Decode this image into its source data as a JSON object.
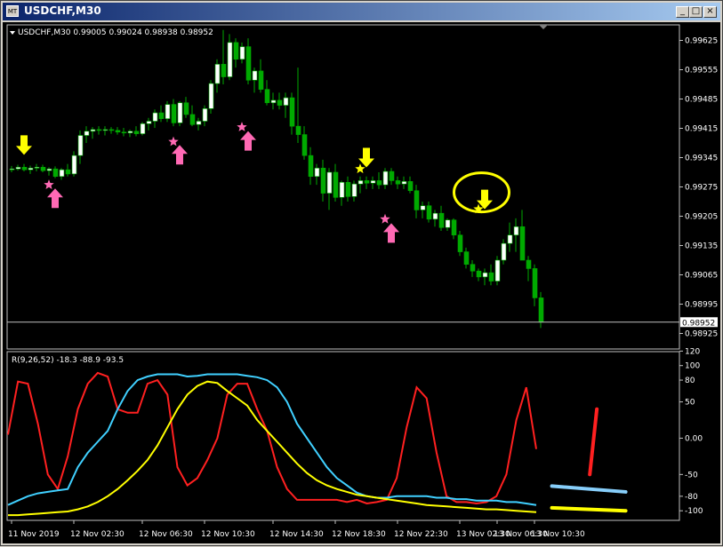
{
  "window": {
    "title": "USDCHF,M30",
    "icon_label": "MT",
    "minimize_label": "_",
    "maximize_label": "□",
    "close_label": "×"
  },
  "price_chart": {
    "header": "USDCHF,M30  0.99005 0.99024 0.98938 0.98952",
    "current_price": 0.98952,
    "current_price_label": "0.98952",
    "y_range": [
      0.9889,
      0.9966
    ],
    "y_ticks": [
      "0.99625",
      "0.99555",
      "0.99485",
      "0.99415",
      "0.99345",
      "0.99275",
      "0.99205",
      "0.99135",
      "0.99065",
      "0.98995",
      "0.98925"
    ],
    "candles": [
      [
        0.99317,
        0.99325,
        0.9931,
        0.99318
      ],
      [
        0.99318,
        0.99328,
        0.99314,
        0.99322
      ],
      [
        0.99322,
        0.9933,
        0.99312,
        0.99316
      ],
      [
        0.99316,
        0.99326,
        0.99306,
        0.9932
      ],
      [
        0.9932,
        0.9933,
        0.99312,
        0.99322
      ],
      [
        0.99322,
        0.99328,
        0.9931,
        0.99314
      ],
      [
        0.99314,
        0.99322,
        0.99302,
        0.99318
      ],
      [
        0.99318,
        0.99324,
        0.99296,
        0.993
      ],
      [
        0.993,
        0.9932,
        0.99292,
        0.99316
      ],
      [
        0.99316,
        0.9933,
        0.993,
        0.99306
      ],
      [
        0.99306,
        0.9936,
        0.993,
        0.9935
      ],
      [
        0.9935,
        0.9941,
        0.9933,
        0.99398
      ],
      [
        0.99398,
        0.9942,
        0.9938,
        0.99408
      ],
      [
        0.99408,
        0.99418,
        0.9939,
        0.99412
      ],
      [
        0.99412,
        0.9942,
        0.994,
        0.9941
      ],
      [
        0.9941,
        0.9942,
        0.99398,
        0.99412
      ],
      [
        0.99412,
        0.99418,
        0.99402,
        0.9941
      ],
      [
        0.9941,
        0.99418,
        0.994,
        0.99406
      ],
      [
        0.99406,
        0.99416,
        0.99396,
        0.99404
      ],
      [
        0.99404,
        0.99412,
        0.99394,
        0.99408
      ],
      [
        0.99408,
        0.9942,
        0.99396,
        0.99402
      ],
      [
        0.99402,
        0.9943,
        0.99398,
        0.99426
      ],
      [
        0.99426,
        0.9944,
        0.9941,
        0.99432
      ],
      [
        0.99432,
        0.9946,
        0.99416,
        0.99452
      ],
      [
        0.99452,
        0.9947,
        0.9943,
        0.99438
      ],
      [
        0.99438,
        0.9948,
        0.9943,
        0.99472
      ],
      [
        0.99472,
        0.99485,
        0.9942,
        0.99428
      ],
      [
        0.99428,
        0.9948,
        0.9942,
        0.99476
      ],
      [
        0.99476,
        0.9949,
        0.9944,
        0.99448
      ],
      [
        0.99448,
        0.9947,
        0.9942,
        0.99424
      ],
      [
        0.99424,
        0.9944,
        0.9941,
        0.99432
      ],
      [
        0.99432,
        0.9947,
        0.9942,
        0.99462
      ],
      [
        0.99462,
        0.9953,
        0.9945,
        0.99522
      ],
      [
        0.99522,
        0.9958,
        0.995,
        0.99568
      ],
      [
        0.99568,
        0.9965,
        0.9952,
        0.99538
      ],
      [
        0.99538,
        0.9964,
        0.9953,
        0.9962
      ],
      [
        0.9962,
        0.9963,
        0.9956,
        0.9958
      ],
      [
        0.9958,
        0.9962,
        0.9957,
        0.9961
      ],
      [
        0.9961,
        0.9963,
        0.9952,
        0.9953
      ],
      [
        0.9953,
        0.9956,
        0.995,
        0.99552
      ],
      [
        0.99552,
        0.9958,
        0.995,
        0.99508
      ],
      [
        0.99508,
        0.9953,
        0.9947,
        0.99476
      ],
      [
        0.99476,
        0.995,
        0.9946,
        0.99482
      ],
      [
        0.99482,
        0.995,
        0.9946,
        0.9947
      ],
      [
        0.9947,
        0.995,
        0.9944,
        0.99488
      ],
      [
        0.99488,
        0.995,
        0.994,
        0.9942
      ],
      [
        0.9942,
        0.9956,
        0.9938,
        0.994
      ],
      [
        0.994,
        0.9942,
        0.9934,
        0.9935
      ],
      [
        0.9935,
        0.9937,
        0.9928,
        0.993
      ],
      [
        0.993,
        0.9933,
        0.9928,
        0.9932
      ],
      [
        0.9932,
        0.9934,
        0.9924,
        0.9926
      ],
      [
        0.9926,
        0.9932,
        0.9922,
        0.9931
      ],
      [
        0.9931,
        0.9933,
        0.9924,
        0.9925
      ],
      [
        0.9925,
        0.9929,
        0.9923,
        0.99286
      ],
      [
        0.99286,
        0.993,
        0.9924,
        0.99252
      ],
      [
        0.99252,
        0.9929,
        0.9924,
        0.99282
      ],
      [
        0.99282,
        0.993,
        0.9926,
        0.9929
      ],
      [
        0.9929,
        0.993,
        0.9927,
        0.99284
      ],
      [
        0.99284,
        0.993,
        0.9927,
        0.9929
      ],
      [
        0.9929,
        0.9931,
        0.9927,
        0.9928
      ],
      [
        0.9928,
        0.9932,
        0.9927,
        0.99312
      ],
      [
        0.99312,
        0.9932,
        0.9928,
        0.9929
      ],
      [
        0.9929,
        0.993,
        0.9927,
        0.99282
      ],
      [
        0.99282,
        0.993,
        0.9927,
        0.99288
      ],
      [
        0.99288,
        0.993,
        0.9926,
        0.99266
      ],
      [
        0.99266,
        0.9928,
        0.992,
        0.9922
      ],
      [
        0.9922,
        0.9924,
        0.992,
        0.9923
      ],
      [
        0.9923,
        0.9924,
        0.9919,
        0.99198
      ],
      [
        0.99198,
        0.9922,
        0.9918,
        0.99212
      ],
      [
        0.99212,
        0.9923,
        0.9917,
        0.99178
      ],
      [
        0.99178,
        0.992,
        0.9917,
        0.99196
      ],
      [
        0.99196,
        0.992,
        0.9915,
        0.9916
      ],
      [
        0.9916,
        0.9917,
        0.9911,
        0.9912
      ],
      [
        0.9912,
        0.9913,
        0.9908,
        0.9909
      ],
      [
        0.9909,
        0.991,
        0.9906,
        0.99074
      ],
      [
        0.99074,
        0.9908,
        0.9905,
        0.9906
      ],
      [
        0.9906,
        0.9908,
        0.9904,
        0.9907
      ],
      [
        0.9907,
        0.9909,
        0.9904,
        0.9905
      ],
      [
        0.9905,
        0.9911,
        0.9904,
        0.991
      ],
      [
        0.991,
        0.9915,
        0.9909,
        0.9914
      ],
      [
        0.9914,
        0.9919,
        0.9912,
        0.9916
      ],
      [
        0.9916,
        0.992,
        0.9912,
        0.9918
      ],
      [
        0.9918,
        0.9922,
        0.9916,
        0.991
      ],
      [
        0.991,
        0.9911,
        0.9905,
        0.9908
      ],
      [
        0.9908,
        0.9909,
        0.9899,
        0.9901
      ],
      [
        0.9901,
        0.99024,
        0.98938,
        0.98952
      ]
    ],
    "markers": [
      {
        "type": "arrow-down",
        "color": "#ffff00",
        "bar": 2,
        "price": 0.99375
      },
      {
        "type": "star",
        "color": "#ff69b4",
        "bar": 6,
        "price": 0.9928
      },
      {
        "type": "arrow-up",
        "color": "#ff69b4",
        "bar": 7,
        "price": 0.99248
      },
      {
        "type": "star",
        "color": "#ff69b4",
        "bar": 26,
        "price": 0.99383
      },
      {
        "type": "arrow-up",
        "color": "#ff69b4",
        "bar": 27,
        "price": 0.99352
      },
      {
        "type": "star",
        "color": "#ff69b4",
        "bar": 37,
        "price": 0.99418
      },
      {
        "type": "arrow-up",
        "color": "#ff69b4",
        "bar": 38,
        "price": 0.99385
      },
      {
        "type": "arrow-down",
        "color": "#ffff00",
        "bar": 57,
        "price": 0.99345
      },
      {
        "type": "star",
        "color": "#ffff00",
        "bar": 56,
        "price": 0.99318
      },
      {
        "type": "star",
        "color": "#ff69b4",
        "bar": 60,
        "price": 0.99198
      },
      {
        "type": "arrow-up",
        "color": "#ff69b4",
        "bar": 61,
        "price": 0.99165
      },
      {
        "type": "arrow-down",
        "color": "#ffff00",
        "bar": 76,
        "price": 0.99245
      },
      {
        "type": "star",
        "color": "#ffff00",
        "bar": 75,
        "price": 0.99222
      }
    ],
    "annotation_circle": {
      "bar": 75.5,
      "price": 0.99262,
      "color": "#ffff00"
    }
  },
  "indicator": {
    "header": "R(9,26,52) -18.3 -88.9 -93.5",
    "y_range": [
      -112,
      118
    ],
    "y_ticks": [
      "120",
      "100",
      "80",
      "50",
      "0.00",
      "-50",
      "-80",
      "-100"
    ],
    "y_tick_values": [
      120,
      100,
      80,
      50,
      0,
      -50,
      -80,
      -100
    ],
    "series": [
      {
        "color": "#ff2020",
        "values": [
          5,
          78,
          75,
          20,
          -50,
          -70,
          -25,
          40,
          75,
          90,
          85,
          40,
          35,
          35,
          75,
          80,
          60,
          -40,
          -65,
          -55,
          -30,
          0,
          60,
          75,
          75,
          40,
          10,
          -40,
          -70,
          -85,
          -85,
          -85,
          -85,
          -85,
          -88,
          -85,
          -90,
          -88,
          -85,
          -55,
          15,
          70,
          55,
          -20,
          -80,
          -88,
          -88,
          -90,
          -88,
          -80,
          -50,
          25,
          70,
          -15
        ]
      },
      {
        "color": "#40d0ff",
        "values": [
          -92,
          -86,
          -80,
          -76,
          -74,
          -72,
          -70,
          -40,
          -20,
          -5,
          10,
          40,
          65,
          80,
          85,
          88,
          88,
          88,
          85,
          86,
          88,
          88,
          88,
          88,
          86,
          84,
          80,
          70,
          50,
          20,
          0,
          -20,
          -40,
          -55,
          -65,
          -75,
          -80,
          -82,
          -82,
          -80,
          -80,
          -80,
          -80,
          -82,
          -82,
          -84,
          -84,
          -86,
          -86,
          -86,
          -88,
          -88,
          -90,
          -92
        ]
      },
      {
        "color": "#ffff00",
        "values": [
          -106,
          -106,
          -105,
          -104,
          -103,
          -102,
          -101,
          -98,
          -94,
          -88,
          -80,
          -70,
          -58,
          -45,
          -30,
          -10,
          15,
          40,
          60,
          72,
          78,
          76,
          65,
          55,
          45,
          25,
          10,
          -5,
          -20,
          -35,
          -48,
          -58,
          -65,
          -70,
          -74,
          -78,
          -80,
          -82,
          -84,
          -86,
          -88,
          -90,
          -92,
          -93,
          -94,
          -95,
          -96,
          -97,
          -98,
          -98,
          -99,
          -100,
          -101,
          -102
        ]
      }
    ],
    "annotations": [
      {
        "color": "#ff2020",
        "x1": 0.8665,
        "v1": -50,
        "x2": 0.877,
        "v2": 40,
        "width": 4
      },
      {
        "color": "#87cefa",
        "x1": 0.81,
        "v1": -66,
        "x2": 0.92,
        "v2": -74,
        "width": 4
      },
      {
        "color": "#ffff00",
        "x1": 0.81,
        "v1": -96,
        "x2": 0.92,
        "v2": -100,
        "width": 4
      }
    ]
  },
  "time_axis": {
    "labels": [
      "11 Nov 2019",
      "12 Nov 02:30",
      "12 Nov 06:30",
      "12 Nov 10:30",
      "12 Nov 14:30",
      "12 Nov 18:30",
      "12 Nov 22:30",
      "13 Nov 02:30",
      "13 Nov 06:30",
      "13 Nov 10:30"
    ],
    "label_bars": [
      0,
      10,
      21,
      31,
      42,
      52,
      62,
      72,
      78,
      84
    ]
  },
  "colors": {
    "background": "#000000",
    "frame": "#c0c0c0",
    "candle_bull": "#ffffff",
    "candle_bear": "#00aa00",
    "text": "#ffffff"
  }
}
